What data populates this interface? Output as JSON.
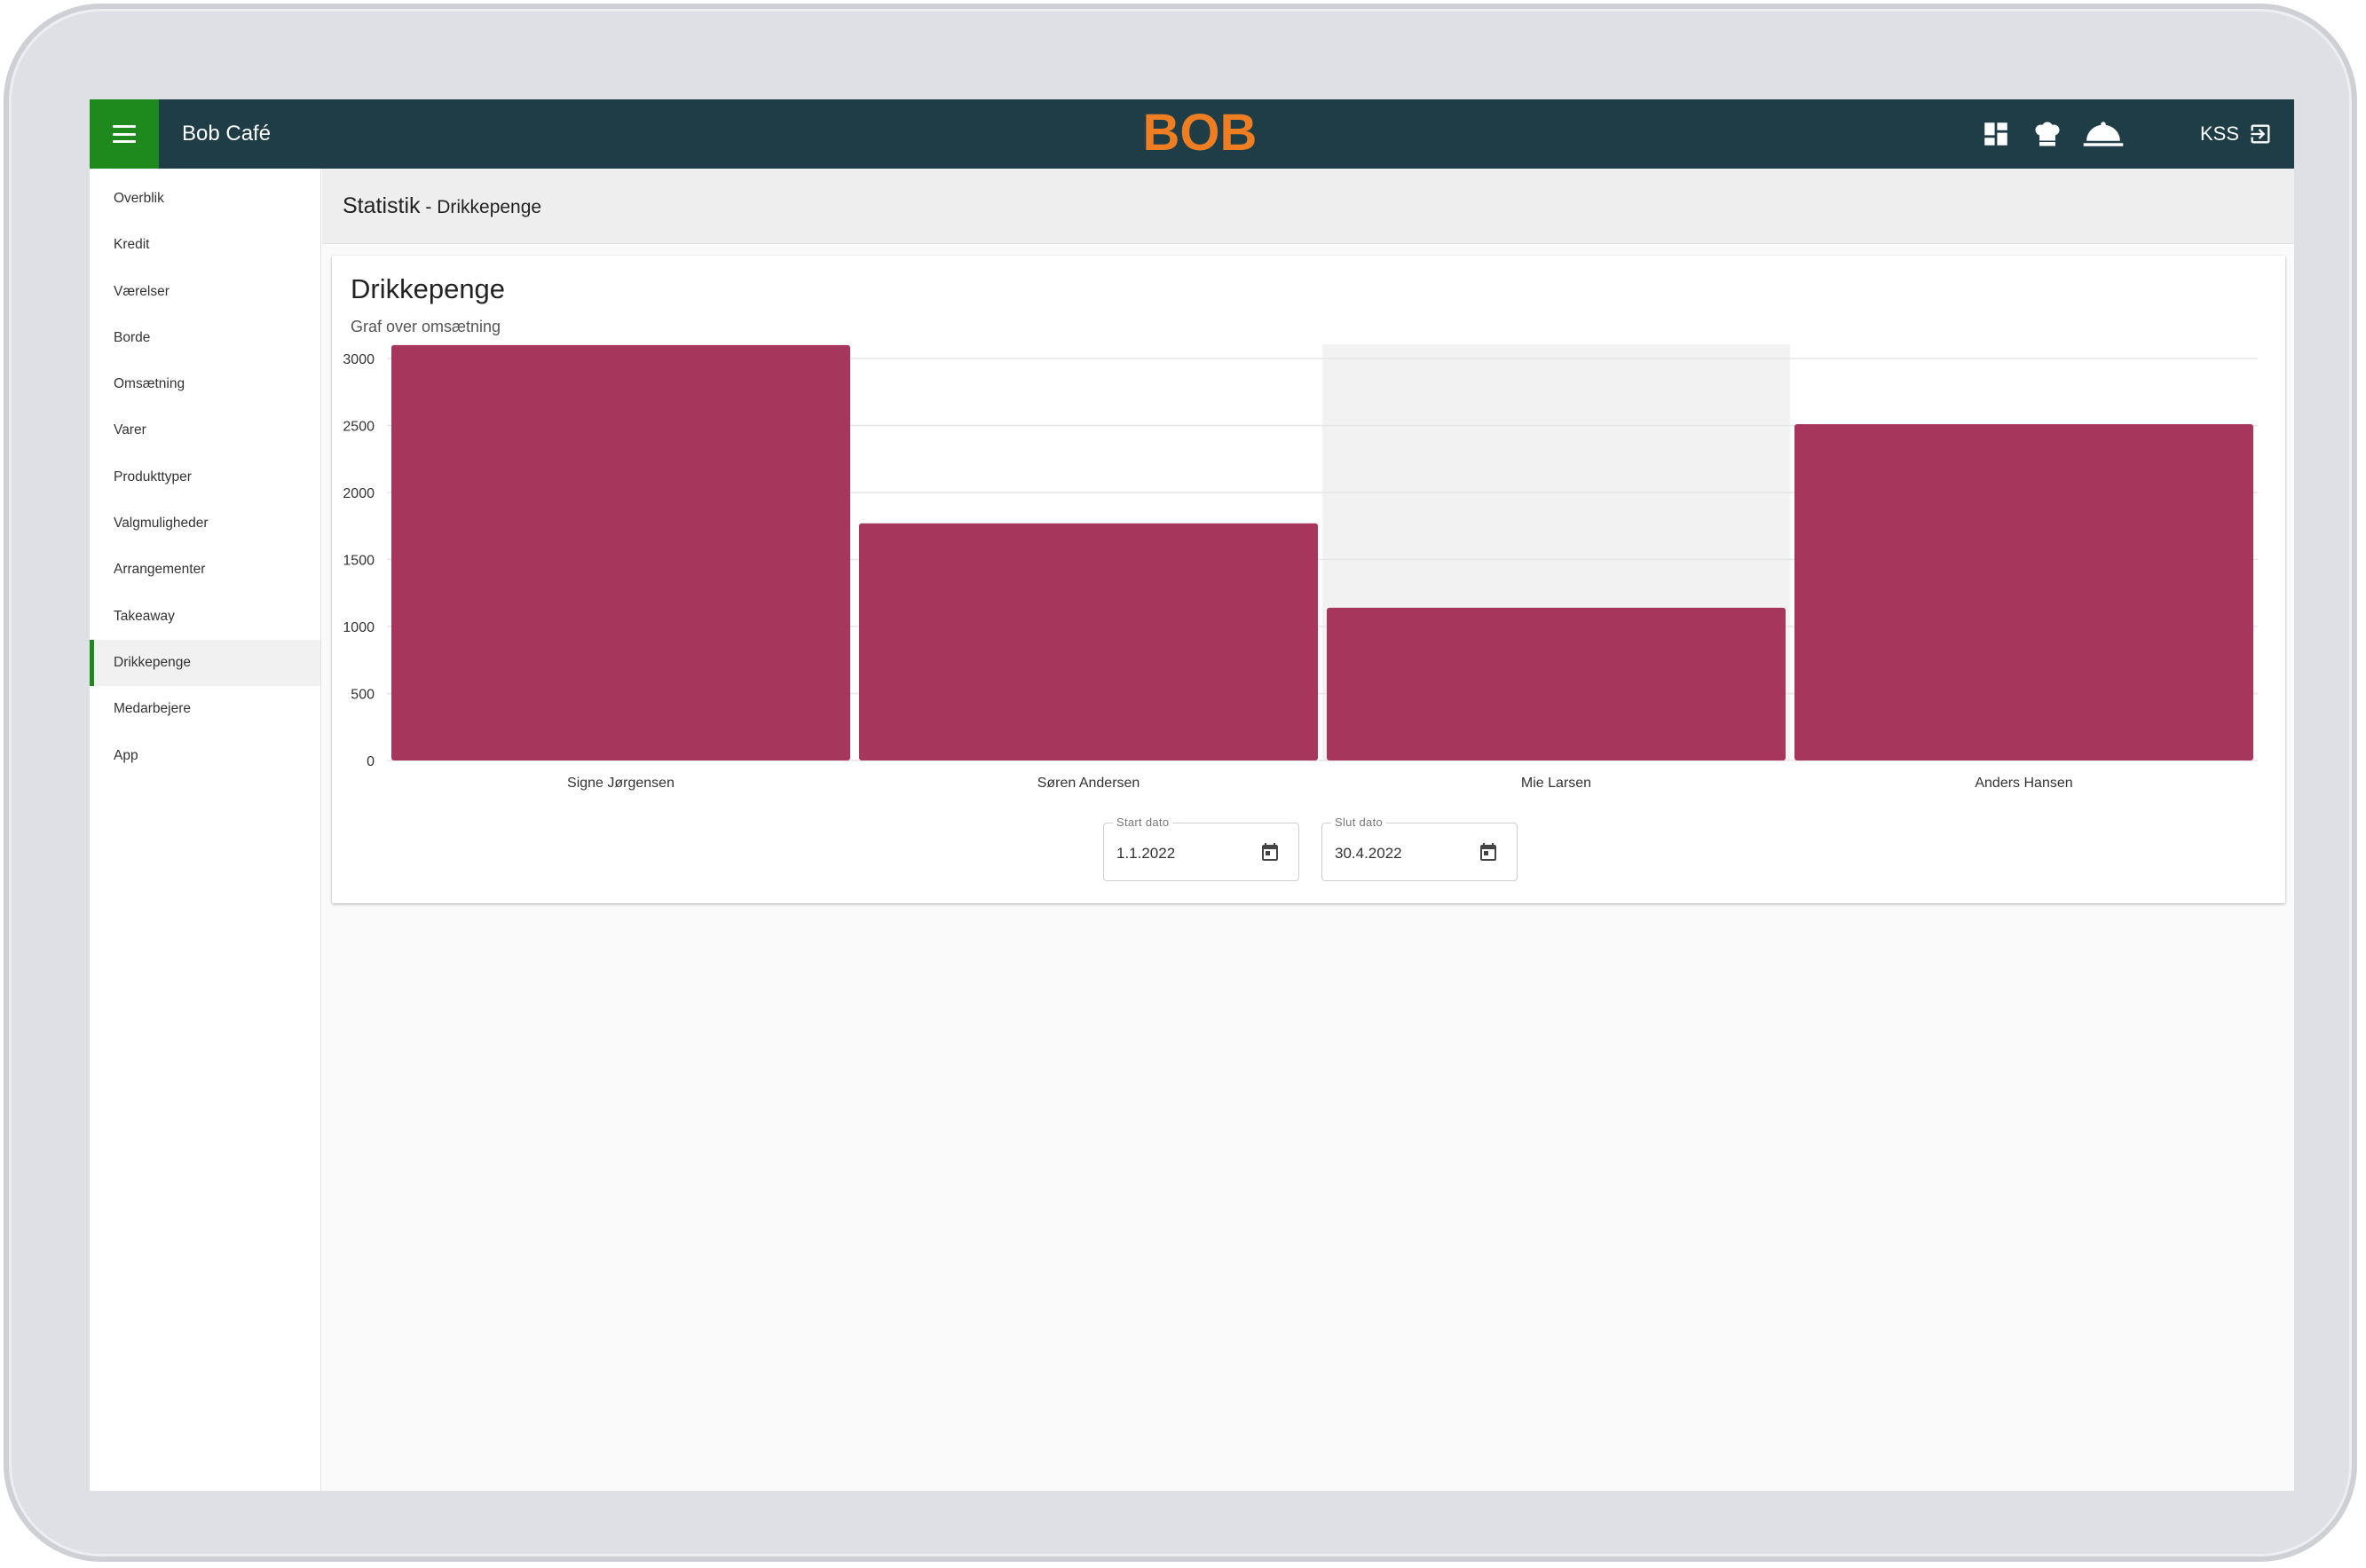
{
  "app": {
    "title": "Bob Café",
    "logo_text": "BOB",
    "user_label": "KSS"
  },
  "header": {
    "icons": [
      "dashboard-icon",
      "chef-hat-icon",
      "cloche-icon",
      "logout-icon"
    ]
  },
  "sidebar": {
    "items": [
      {
        "label": "Overblik"
      },
      {
        "label": "Kredit"
      },
      {
        "label": "Værelser"
      },
      {
        "label": "Borde"
      },
      {
        "label": "Omsætning"
      },
      {
        "label": "Varer"
      },
      {
        "label": "Produkttyper"
      },
      {
        "label": "Valgmuligheder"
      },
      {
        "label": "Arrangementer"
      },
      {
        "label": "Takeaway"
      },
      {
        "label": "Drikkepenge",
        "active": true
      },
      {
        "label": "Medarbejere"
      },
      {
        "label": "App"
      }
    ]
  },
  "page": {
    "title": "Statistik",
    "subtitle": " - Drikkepenge"
  },
  "card": {
    "title": "Drikkepenge",
    "subtitle": "Graf over omsætning"
  },
  "chart_data": {
    "type": "bar",
    "categories": [
      "Signe Jørgensen",
      "Søren Andersen",
      "Mie Larsen",
      "Anders Hansen"
    ],
    "values": [
      3100,
      1770,
      1140,
      2510
    ],
    "ylim": [
      0,
      3000
    ],
    "yticks": [
      0,
      500,
      1000,
      1500,
      2000,
      2500,
      3000
    ],
    "grid": true,
    "highlighted_category": "Mie Larsen",
    "bar_color": "#a6365c",
    "highlight_color": "#f2f2f2"
  },
  "filters": {
    "start_label": "Start dato",
    "start_value": "1.1.2022",
    "end_label": "Slut dato",
    "end_value": "30.4.2022"
  },
  "colors": {
    "header_bg": "#1e3d47",
    "accent_green": "#1e8a1e",
    "logo_orange": "#ef7d22"
  }
}
